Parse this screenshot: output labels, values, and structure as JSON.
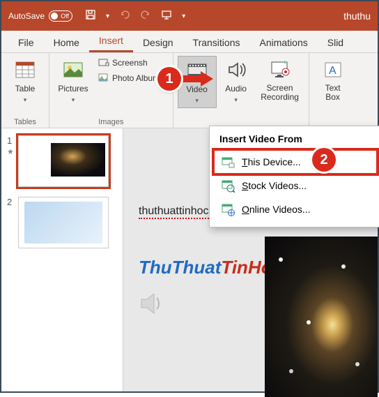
{
  "titlebar": {
    "autosave_label": "AutoSave",
    "autosave_state": "Off",
    "doc_title": "thuthu"
  },
  "tabs": [
    "File",
    "Home",
    "Insert",
    "Design",
    "Transitions",
    "Animations",
    "Slid"
  ],
  "active_tab": "Insert",
  "ribbon": {
    "tables": {
      "label": "Tables",
      "table_btn": "Table"
    },
    "images": {
      "label": "Images",
      "pictures_btn": "Pictures",
      "screenshot": "Screensh",
      "photo_album": "Photo Album"
    },
    "media": {
      "video": "Video",
      "audio": "Audio",
      "screen_rec": "Screen\nRecording"
    },
    "text": {
      "textbox": "Text\nBox"
    }
  },
  "dropdown": {
    "title": "Insert Video From",
    "items": [
      {
        "key": "T",
        "rest": "his Device..."
      },
      {
        "key": "S",
        "rest": "tock Videos..."
      },
      {
        "key": "O",
        "rest": "nline Videos..."
      }
    ]
  },
  "thumbs": {
    "n1": "1",
    "n2": "2"
  },
  "slide": {
    "text1": "thuthuattinhoc",
    "logo_a": "ThuThuat",
    "logo_b": "TinHoc.vn"
  },
  "callouts": {
    "c1": "1",
    "c2": "2"
  }
}
